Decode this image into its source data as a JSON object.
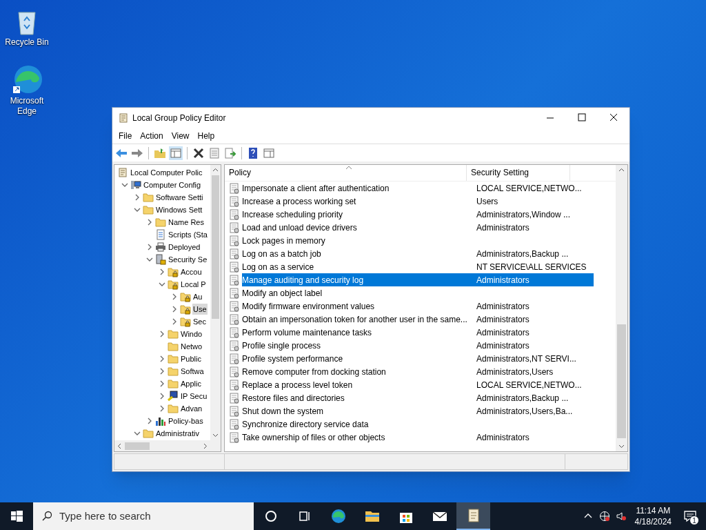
{
  "desktop_icons": [
    {
      "kind": "recycle",
      "label": "Recycle Bin"
    },
    {
      "kind": "edge",
      "label": "Microsoft Edge"
    }
  ],
  "window": {
    "title": "Local Group Policy Editor"
  },
  "menu": [
    "File",
    "Action",
    "View",
    "Help"
  ],
  "toolbar": [
    {
      "kind": "back",
      "disabled": false
    },
    {
      "kind": "forward",
      "disabled": false
    },
    {
      "kind": "sep"
    },
    {
      "kind": "up",
      "disabled": false
    },
    {
      "kind": "showtree",
      "disabled": false
    },
    {
      "kind": "sep"
    },
    {
      "kind": "delete",
      "disabled": false
    },
    {
      "kind": "properties",
      "disabled": false
    },
    {
      "kind": "export",
      "disabled": false
    },
    {
      "kind": "sep"
    },
    {
      "kind": "help",
      "disabled": false
    },
    {
      "kind": "pane",
      "disabled": false
    }
  ],
  "tree": [
    {
      "label": "Local Computer Polic",
      "kind": "scroll",
      "selected": false,
      "children": [
        {
          "label": "Computer Config",
          "kind": "computer",
          "selected": false,
          "expanded": true,
          "children": [
            {
              "label": "Software Setti",
              "kind": "folder",
              "selected": false,
              "expanded": false
            },
            {
              "label": "Windows Sett",
              "kind": "folder",
              "selected": false,
              "expanded": true,
              "children": [
                {
                  "label": "Name Res",
                  "kind": "folder",
                  "selected": false,
                  "expanded": false
                },
                {
                  "label": "Scripts (Sta",
                  "kind": "script",
                  "selected": false
                },
                {
                  "label": "Deployed",
                  "kind": "printer",
                  "selected": false,
                  "expanded": false
                },
                {
                  "label": "Security Se",
                  "kind": "security",
                  "selected": false,
                  "expanded": true,
                  "children": [
                    {
                      "label": "Accou",
                      "kind": "lockfolder",
                      "selected": false,
                      "expanded": false
                    },
                    {
                      "label": "Local P",
                      "kind": "lockfolder",
                      "selected": false,
                      "expanded": true,
                      "children": [
                        {
                          "label": "Au",
                          "kind": "lockfolder",
                          "selected": false,
                          "expanded": false
                        },
                        {
                          "label": "Use",
                          "kind": "lockfolder",
                          "selected": true,
                          "expanded": false
                        },
                        {
                          "label": "Sec",
                          "kind": "lockfolder",
                          "selected": false,
                          "expanded": false
                        }
                      ]
                    },
                    {
                      "label": "Windo",
                      "kind": "folder",
                      "selected": false,
                      "expanded": false
                    },
                    {
                      "label": "Netwo",
                      "kind": "folder",
                      "selected": false
                    },
                    {
                      "label": "Public",
                      "kind": "folder",
                      "selected": false,
                      "expanded": false
                    },
                    {
                      "label": "Softwa",
                      "kind": "folder",
                      "selected": false,
                      "expanded": false
                    },
                    {
                      "label": "Applic",
                      "kind": "folder",
                      "selected": false,
                      "expanded": false
                    },
                    {
                      "label": "IP Secu",
                      "kind": "ipsec",
                      "selected": false,
                      "expanded": false
                    },
                    {
                      "label": "Advan",
                      "kind": "folder",
                      "selected": false,
                      "expanded": false
                    }
                  ]
                },
                {
                  "label": "Policy-bas",
                  "kind": "chart",
                  "selected": false,
                  "expanded": false
                }
              ]
            },
            {
              "label": "Administrativ",
              "kind": "folder",
              "selected": false,
              "expanded": true
            }
          ]
        }
      ]
    }
  ],
  "table": {
    "columns": [
      {
        "label": "Policy",
        "sorted": true
      },
      {
        "label": "Security Setting",
        "sorted": false
      }
    ],
    "rows": [
      {
        "policy": "Impersonate a client after authentication",
        "setting": "LOCAL SERVICE,NETWO...",
        "selected": false
      },
      {
        "policy": "Increase a process working set",
        "setting": "Users",
        "selected": false
      },
      {
        "policy": "Increase scheduling priority",
        "setting": "Administrators,Window ...",
        "selected": false
      },
      {
        "policy": "Load and unload device drivers",
        "setting": "Administrators",
        "selected": false
      },
      {
        "policy": "Lock pages in memory",
        "selected": false
      },
      {
        "policy": "Log on as a batch job",
        "setting": "Administrators,Backup ...",
        "selected": false
      },
      {
        "policy": "Log on as a service",
        "setting": "NT SERVICE\\ALL SERVICES",
        "selected": false
      },
      {
        "policy": "Manage auditing and security log",
        "setting": "Administrators",
        "selected": true
      },
      {
        "policy": "Modify an object label",
        "selected": false
      },
      {
        "policy": "Modify firmware environment values",
        "setting": "Administrators",
        "selected": false
      },
      {
        "policy": "Obtain an impersonation token for another user in the same...",
        "setting": "Administrators",
        "selected": false
      },
      {
        "policy": "Perform volume maintenance tasks",
        "setting": "Administrators",
        "selected": false
      },
      {
        "policy": "Profile single process",
        "setting": "Administrators",
        "selected": false
      },
      {
        "policy": "Profile system performance",
        "setting": "Administrators,NT SERVI...",
        "selected": false
      },
      {
        "policy": "Remove computer from docking station",
        "setting": "Administrators,Users",
        "selected": false
      },
      {
        "policy": "Replace a process level token",
        "setting": "LOCAL SERVICE,NETWO...",
        "selected": false
      },
      {
        "policy": "Restore files and directories",
        "setting": "Administrators,Backup ...",
        "selected": false
      },
      {
        "policy": "Shut down the system",
        "setting": "Administrators,Users,Ba...",
        "selected": false
      },
      {
        "policy": "Synchronize directory service data",
        "selected": false
      },
      {
        "policy": "Take ownership of files or other objects",
        "setting": "Administrators",
        "selected": false
      }
    ]
  },
  "taskbar": {
    "search": {
      "placeholder": "Type here to search"
    },
    "apps": [
      {
        "kind": "cortana",
        "active": false
      },
      {
        "kind": "taskview",
        "active": false
      },
      {
        "kind": "edge",
        "active": false
      },
      {
        "kind": "explorer",
        "active": false
      },
      {
        "kind": "store",
        "active": false
      },
      {
        "kind": "mail",
        "active": false
      },
      {
        "kind": "gpedit",
        "active": true
      }
    ],
    "time": "11:14 AM",
    "date": "4/18/2024",
    "notifications": "1"
  }
}
